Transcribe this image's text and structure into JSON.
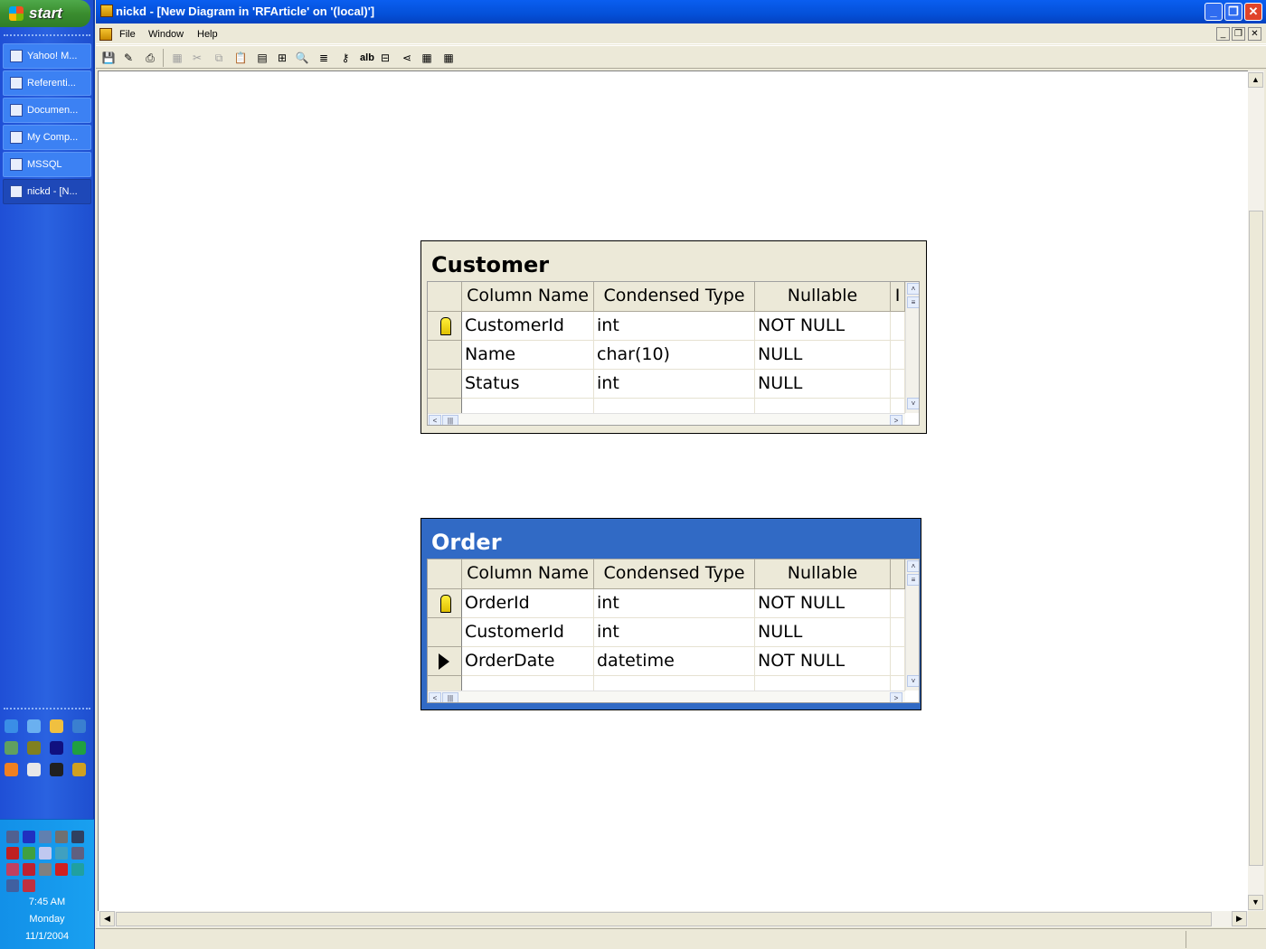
{
  "taskbar": {
    "start_label": "start",
    "buttons": [
      {
        "label": "Yahoo! M..."
      },
      {
        "label": "Referenti..."
      },
      {
        "label": "Documen..."
      },
      {
        "label": "My Comp..."
      },
      {
        "label": "MSSQL"
      },
      {
        "label": "nickd - [N..."
      }
    ],
    "clock": {
      "time": "7:45 AM",
      "day": "Monday",
      "date": "11/1/2004"
    }
  },
  "window": {
    "title": "nickd - [New Diagram in 'RFArticle' on '(local)']",
    "menu": [
      "File",
      "Window",
      "Help"
    ],
    "toolbar": [
      "save-icon",
      "properties-icon",
      "print-icon",
      "generate-script-icon",
      "cut-icon",
      "copy-icon",
      "paste-icon",
      "new-table-icon",
      "add-table-icon",
      "zoom-icon",
      "table-view-icon",
      "primary-key-icon",
      "new-text-annotation-icon",
      "arrange-tables-icon",
      "show-relationship-labels-icon",
      "manage-indexes-icon",
      "table-properties-icon"
    ]
  },
  "tables": [
    {
      "name": "Customer",
      "selected": false,
      "headers": [
        "Column Name",
        "Condensed Type",
        "Nullable",
        "I"
      ],
      "rows": [
        {
          "name": "CustomerId",
          "type": "int",
          "nullable": "NOT NULL",
          "pk": true
        },
        {
          "name": "Name",
          "type": "char(10)",
          "nullable": "NULL",
          "pk": false
        },
        {
          "name": "Status",
          "type": "int",
          "nullable": "NULL",
          "pk": false
        }
      ]
    },
    {
      "name": "Order",
      "selected": true,
      "headers": [
        "Column Name",
        "Condensed Type",
        "Nullable",
        ""
      ],
      "rows": [
        {
          "name": "OrderId",
          "type": "int",
          "nullable": "NOT NULL",
          "pk": true
        },
        {
          "name": "CustomerId",
          "type": "int",
          "nullable": "NULL",
          "pk": false
        },
        {
          "name": "OrderDate",
          "type": "datetime",
          "nullable": "NOT NULL",
          "pk": false,
          "current": true
        }
      ]
    }
  ]
}
